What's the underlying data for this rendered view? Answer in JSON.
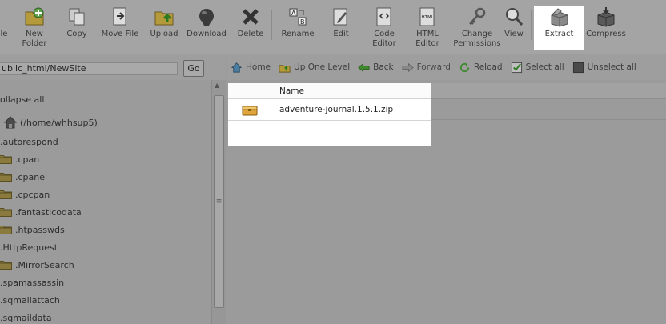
{
  "toolbar": {
    "buttons": [
      {
        "id": "file",
        "label": "le",
        "icon": "new-file-icon"
      },
      {
        "id": "new-folder",
        "label": "New\nFolder",
        "icon": "new-folder-icon"
      },
      {
        "id": "copy",
        "label": "Copy",
        "icon": "copy-icon"
      },
      {
        "id": "move-file",
        "label": "Move File",
        "icon": "move-file-icon"
      },
      {
        "id": "upload",
        "label": "Upload",
        "icon": "upload-icon"
      },
      {
        "id": "download",
        "label": "Download",
        "icon": "download-icon"
      },
      {
        "id": "delete",
        "label": "Delete",
        "icon": "delete-icon"
      },
      {
        "id": "rename",
        "label": "Rename",
        "icon": "rename-icon"
      },
      {
        "id": "edit",
        "label": "Edit",
        "icon": "edit-icon"
      },
      {
        "id": "code-editor",
        "label": "Code\nEditor",
        "icon": "code-editor-icon"
      },
      {
        "id": "html-editor",
        "label": "HTML\nEditor",
        "icon": "html-editor-icon"
      },
      {
        "id": "change-permissions",
        "label": "Change\nPermissions",
        "icon": "permissions-icon"
      },
      {
        "id": "view",
        "label": "View",
        "icon": "view-icon"
      },
      {
        "id": "extract",
        "label": "Extract",
        "icon": "extract-icon"
      },
      {
        "id": "compress",
        "label": "Compress",
        "icon": "compress-icon"
      }
    ],
    "html_icon_text": "HTML"
  },
  "path": {
    "value": "ublic_html/NewSite",
    "go_label": "Go"
  },
  "tree": {
    "collapse_all": "ollapse all",
    "home_label": "(/home/whhsup5)",
    "items": [
      {
        "label": ".autorespond",
        "folder": false
      },
      {
        "label": ".cpan",
        "folder": true
      },
      {
        "label": ".cpanel",
        "folder": true
      },
      {
        "label": ".cpcpan",
        "folder": true
      },
      {
        "label": ".fantasticodata",
        "folder": true
      },
      {
        "label": ".htpasswds",
        "folder": true
      },
      {
        "label": ".HttpRequest",
        "folder": false
      },
      {
        "label": ".MirrorSearch",
        "folder": true
      },
      {
        "label": ".spamassassin",
        "folder": false
      },
      {
        "label": ".sqmailattach",
        "folder": false
      },
      {
        "label": ".sqmaildata",
        "folder": false
      }
    ]
  },
  "nav": {
    "home": "Home",
    "up_one_level": "Up One Level",
    "back": "Back",
    "forward": "Forward",
    "reload": "Reload",
    "select_all": "Select all",
    "unselect_all": "Unselect all"
  },
  "files": {
    "header_name": "Name",
    "rows": [
      {
        "name": "adventure-journal.1.5.1.zip",
        "icon": "archive-icon"
      }
    ]
  },
  "scrollbar": {
    "up_glyph": "▲",
    "grip_glyph": "≡"
  },
  "colors": {
    "highlight": "#ffffff",
    "overlay": "#9b9b9b"
  }
}
